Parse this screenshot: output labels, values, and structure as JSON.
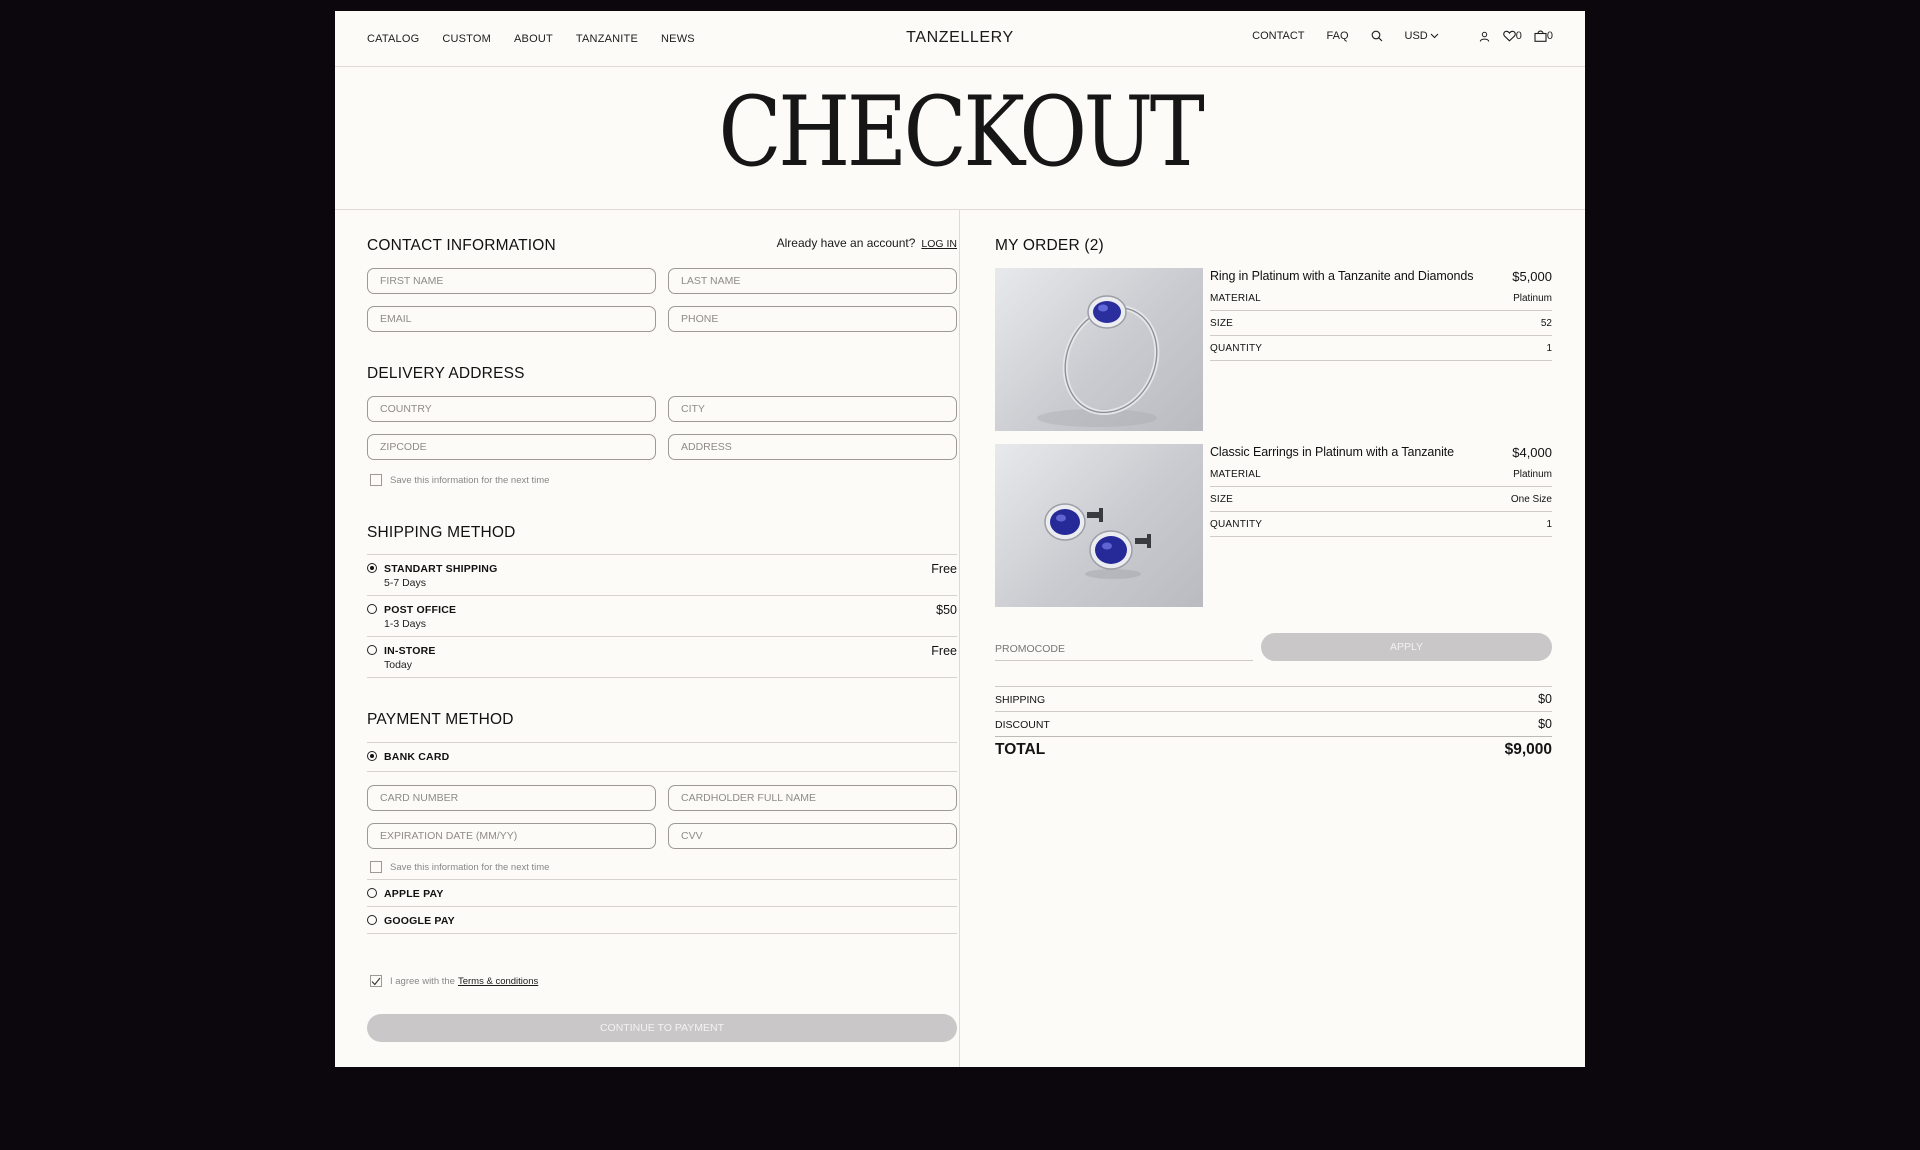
{
  "header": {
    "nav_left": [
      "CATALOG",
      "CUSTOM",
      "ABOUT",
      "TANZANITE",
      "NEWS"
    ],
    "brand": "TANZELLERY",
    "contact": "CONTACT",
    "faq": "FAQ",
    "currency": "USD",
    "wishlist_count": "0",
    "cart_count": "0"
  },
  "hero": {
    "title": "CHECKOUT"
  },
  "contact": {
    "title": "CONTACT INFORMATION",
    "account_prompt": "Already have an account?",
    "login": "LOG IN",
    "first_name": "FIRST NAME",
    "last_name": "LAST NAME",
    "email": "EMAIL",
    "phone": "PHONE"
  },
  "delivery": {
    "title": "DELIVERY ADDRESS",
    "country": "COUNTRY",
    "city": "CITY",
    "zipcode": "ZIPCODE",
    "address": "ADDRESS",
    "save": "Save this information for the next time"
  },
  "shipping": {
    "title": "SHIPPING METHOD",
    "options": [
      {
        "label": "STANDART SHIPPING",
        "sub": "5-7 Days",
        "price": "Free",
        "selected": true
      },
      {
        "label": "POST OFFICE",
        "sub": "1-3 Days",
        "price": "$50",
        "selected": false
      },
      {
        "label": "IN-STORE",
        "sub": "Today",
        "price": "Free",
        "selected": false
      }
    ]
  },
  "payment": {
    "title": "PAYMENT METHOD",
    "bank_card": "BANK CARD",
    "card_number": "CARD NUMBER",
    "cardholder": "CARDHOLDER FULL NAME",
    "expiration": "EXPIRATION DATE (MM/YY)",
    "cvv": "CVV",
    "save": "Save this information for the next time",
    "apple_pay": "APPLE PAY",
    "google_pay": "GOOGLE PAY",
    "agree_prefix": "I agree with the",
    "terms": "Terms & conditions",
    "continue": "CONTINUE TO PAYMENT"
  },
  "order": {
    "title": "MY ORDER (2)",
    "items": [
      {
        "name": "Ring in Platinum with a Tanzanite and Diamonds",
        "price": "$5,000",
        "specs": [
          {
            "k": "MATERIAL",
            "v": "Platinum"
          },
          {
            "k": "SIZE",
            "v": "52"
          },
          {
            "k": "QUANTITY",
            "v": "1"
          }
        ]
      },
      {
        "name": "Classic Earrings in Platinum with a Tanzanite",
        "price": "$4,000",
        "specs": [
          {
            "k": "MATERIAL",
            "v": "Platinum"
          },
          {
            "k": "SIZE",
            "v": "One Size"
          },
          {
            "k": "QUANTITY",
            "v": "1"
          }
        ]
      }
    ],
    "promo_placeholder": "PROMOCODE",
    "apply": "APPLY",
    "shipping_label": "SHIPPING",
    "shipping_value": "$0",
    "discount_label": "DISCOUNT",
    "discount_value": "$0",
    "total_label": "TOTAL",
    "total_value": "$9,000"
  }
}
